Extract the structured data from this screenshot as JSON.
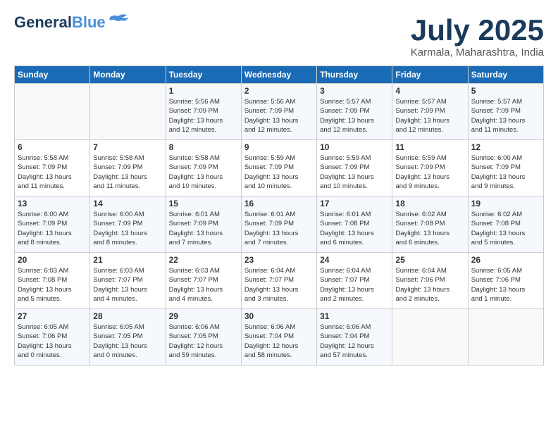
{
  "header": {
    "logo_line1": "General",
    "logo_line2": "Blue",
    "month": "July 2025",
    "location": "Karmala, Maharashtra, India"
  },
  "weekdays": [
    "Sunday",
    "Monday",
    "Tuesday",
    "Wednesday",
    "Thursday",
    "Friday",
    "Saturday"
  ],
  "weeks": [
    [
      {
        "day": "",
        "info": ""
      },
      {
        "day": "",
        "info": ""
      },
      {
        "day": "1",
        "info": "Sunrise: 5:56 AM\nSunset: 7:09 PM\nDaylight: 13 hours\nand 12 minutes."
      },
      {
        "day": "2",
        "info": "Sunrise: 5:56 AM\nSunset: 7:09 PM\nDaylight: 13 hours\nand 12 minutes."
      },
      {
        "day": "3",
        "info": "Sunrise: 5:57 AM\nSunset: 7:09 PM\nDaylight: 13 hours\nand 12 minutes."
      },
      {
        "day": "4",
        "info": "Sunrise: 5:57 AM\nSunset: 7:09 PM\nDaylight: 13 hours\nand 12 minutes."
      },
      {
        "day": "5",
        "info": "Sunrise: 5:57 AM\nSunset: 7:09 PM\nDaylight: 13 hours\nand 11 minutes."
      }
    ],
    [
      {
        "day": "6",
        "info": "Sunrise: 5:58 AM\nSunset: 7:09 PM\nDaylight: 13 hours\nand 11 minutes."
      },
      {
        "day": "7",
        "info": "Sunrise: 5:58 AM\nSunset: 7:09 PM\nDaylight: 13 hours\nand 11 minutes."
      },
      {
        "day": "8",
        "info": "Sunrise: 5:58 AM\nSunset: 7:09 PM\nDaylight: 13 hours\nand 10 minutes."
      },
      {
        "day": "9",
        "info": "Sunrise: 5:59 AM\nSunset: 7:09 PM\nDaylight: 13 hours\nand 10 minutes."
      },
      {
        "day": "10",
        "info": "Sunrise: 5:59 AM\nSunset: 7:09 PM\nDaylight: 13 hours\nand 10 minutes."
      },
      {
        "day": "11",
        "info": "Sunrise: 5:59 AM\nSunset: 7:09 PM\nDaylight: 13 hours\nand 9 minutes."
      },
      {
        "day": "12",
        "info": "Sunrise: 6:00 AM\nSunset: 7:09 PM\nDaylight: 13 hours\nand 9 minutes."
      }
    ],
    [
      {
        "day": "13",
        "info": "Sunrise: 6:00 AM\nSunset: 7:09 PM\nDaylight: 13 hours\nand 8 minutes."
      },
      {
        "day": "14",
        "info": "Sunrise: 6:00 AM\nSunset: 7:09 PM\nDaylight: 13 hours\nand 8 minutes."
      },
      {
        "day": "15",
        "info": "Sunrise: 6:01 AM\nSunset: 7:09 PM\nDaylight: 13 hours\nand 7 minutes."
      },
      {
        "day": "16",
        "info": "Sunrise: 6:01 AM\nSunset: 7:09 PM\nDaylight: 13 hours\nand 7 minutes."
      },
      {
        "day": "17",
        "info": "Sunrise: 6:01 AM\nSunset: 7:08 PM\nDaylight: 13 hours\nand 6 minutes."
      },
      {
        "day": "18",
        "info": "Sunrise: 6:02 AM\nSunset: 7:08 PM\nDaylight: 13 hours\nand 6 minutes."
      },
      {
        "day": "19",
        "info": "Sunrise: 6:02 AM\nSunset: 7:08 PM\nDaylight: 13 hours\nand 5 minutes."
      }
    ],
    [
      {
        "day": "20",
        "info": "Sunrise: 6:03 AM\nSunset: 7:08 PM\nDaylight: 13 hours\nand 5 minutes."
      },
      {
        "day": "21",
        "info": "Sunrise: 6:03 AM\nSunset: 7:07 PM\nDaylight: 13 hours\nand 4 minutes."
      },
      {
        "day": "22",
        "info": "Sunrise: 6:03 AM\nSunset: 7:07 PM\nDaylight: 13 hours\nand 4 minutes."
      },
      {
        "day": "23",
        "info": "Sunrise: 6:04 AM\nSunset: 7:07 PM\nDaylight: 13 hours\nand 3 minutes."
      },
      {
        "day": "24",
        "info": "Sunrise: 6:04 AM\nSunset: 7:07 PM\nDaylight: 13 hours\nand 2 minutes."
      },
      {
        "day": "25",
        "info": "Sunrise: 6:04 AM\nSunset: 7:06 PM\nDaylight: 13 hours\nand 2 minutes."
      },
      {
        "day": "26",
        "info": "Sunrise: 6:05 AM\nSunset: 7:06 PM\nDaylight: 13 hours\nand 1 minute."
      }
    ],
    [
      {
        "day": "27",
        "info": "Sunrise: 6:05 AM\nSunset: 7:06 PM\nDaylight: 13 hours\nand 0 minutes."
      },
      {
        "day": "28",
        "info": "Sunrise: 6:05 AM\nSunset: 7:05 PM\nDaylight: 13 hours\nand 0 minutes."
      },
      {
        "day": "29",
        "info": "Sunrise: 6:06 AM\nSunset: 7:05 PM\nDaylight: 12 hours\nand 59 minutes."
      },
      {
        "day": "30",
        "info": "Sunrise: 6:06 AM\nSunset: 7:04 PM\nDaylight: 12 hours\nand 58 minutes."
      },
      {
        "day": "31",
        "info": "Sunrise: 6:06 AM\nSunset: 7:04 PM\nDaylight: 12 hours\nand 57 minutes."
      },
      {
        "day": "",
        "info": ""
      },
      {
        "day": "",
        "info": ""
      }
    ]
  ]
}
